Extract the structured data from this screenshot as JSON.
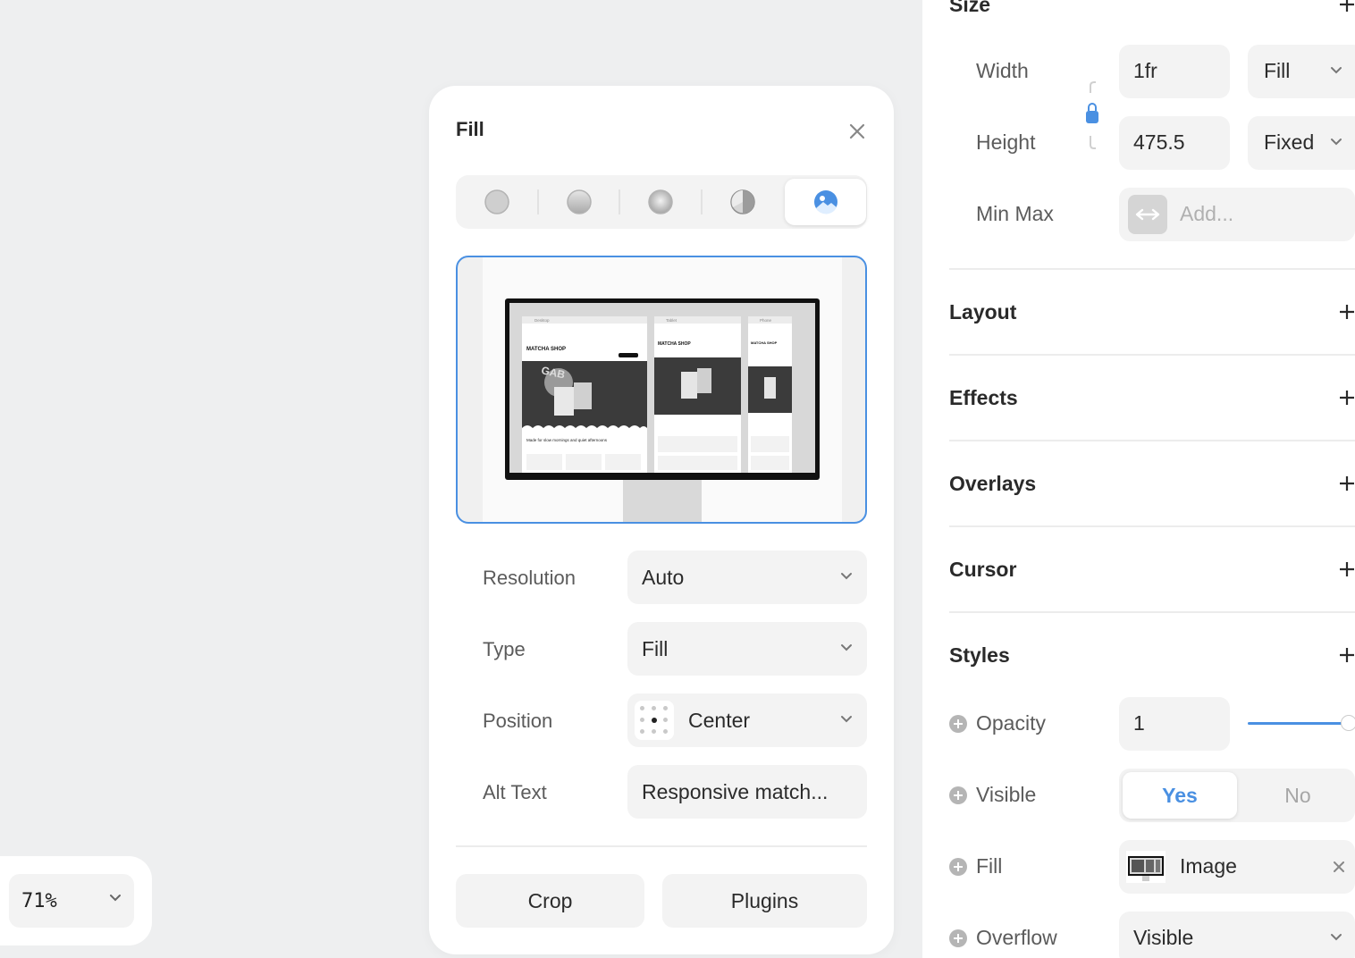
{
  "zoom": {
    "value": "71%"
  },
  "fill_popover": {
    "title": "Fill",
    "fill_types": [
      "solid-fill-icon",
      "linear-gradient-icon",
      "radial-gradient-icon",
      "conic-gradient-icon",
      "image-fill-icon"
    ],
    "active_fill_type": "image",
    "preview": {
      "brand": "MATCHA SHOP",
      "tagline": "Made for slow mornings and quiet afternoons",
      "window_labels": [
        "Desktop",
        "Tablet",
        "Phone"
      ]
    },
    "rows": [
      {
        "label": "Resolution",
        "value": "Auto"
      },
      {
        "label": "Type",
        "value": "Fill"
      },
      {
        "label": "Position",
        "value": "Center"
      },
      {
        "label": "Alt Text",
        "value": "Responsive match..."
      }
    ],
    "buttons": {
      "crop": "Crop",
      "plugins": "Plugins"
    }
  },
  "panel": {
    "size": {
      "title": "Size",
      "width": {
        "label": "Width",
        "value": "1fr",
        "mode": "Fill"
      },
      "height": {
        "label": "Height",
        "value": "475.5",
        "mode": "Fixed"
      },
      "minmax": {
        "label": "Min Max",
        "placeholder": "Add..."
      }
    },
    "sections": [
      "Layout",
      "Effects",
      "Overlays",
      "Cursor",
      "Styles"
    ],
    "styles": {
      "opacity": {
        "label": "Opacity",
        "value": "1",
        "slider_fraction": 1.0
      },
      "visible": {
        "label": "Visible",
        "yes": "Yes",
        "no": "No",
        "selected": "Yes"
      },
      "fill": {
        "label": "Fill",
        "value": "Image"
      },
      "overflow": {
        "label": "Overflow",
        "value": "Visible"
      }
    }
  },
  "colors": {
    "accent": "#4a90e2",
    "field_bg": "#f3f3f3",
    "canvas_bg": "#eeeff0"
  }
}
